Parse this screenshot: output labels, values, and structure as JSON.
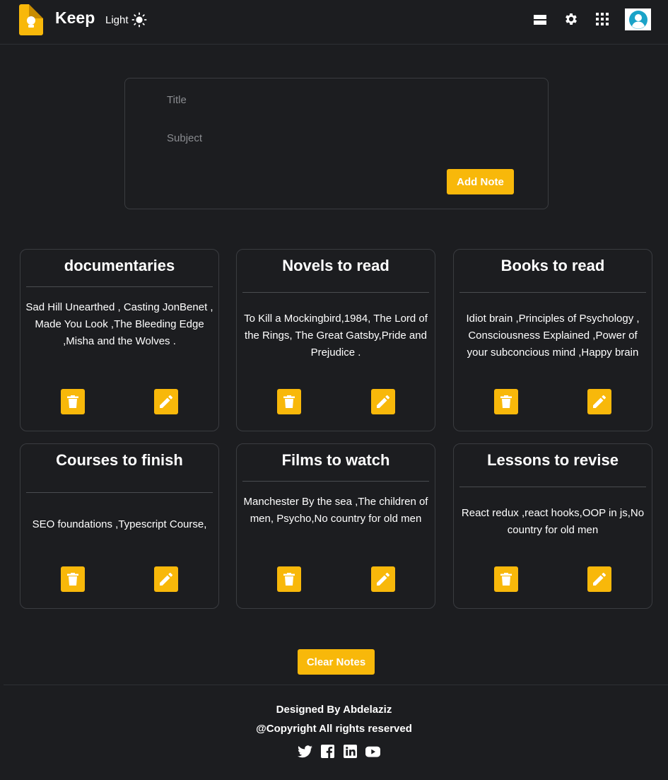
{
  "header": {
    "app_name": "Keep",
    "theme_label": "Light",
    "icons": [
      "sun-icon",
      "view-list-icon",
      "gear-icon",
      "apps-grid-icon",
      "user-avatar-icon"
    ]
  },
  "form": {
    "title_placeholder": "Title",
    "subject_placeholder": "Subject",
    "add_label": "Add Note"
  },
  "notes": [
    {
      "title": "documentaries",
      "body": "Sad Hill Unearthed , Casting JonBenet , Made You Look ,The Bleeding Edge ,Misha and the Wolves ."
    },
    {
      "title": "Novels to read",
      "body": "To Kill a Mockingbird,1984, The Lord of the Rings, The Great Gatsby,Pride and Prejudice ."
    },
    {
      "title": "Books to read",
      "body": "Idiot brain ,Principles of Psychology , Consciousness Explained ,Power of your subconcious mind ,Happy brain"
    },
    {
      "title": "Courses to finish",
      "body": "SEO foundations ,Typescript Course,"
    },
    {
      "title": "Films to watch",
      "body": "Manchester By the sea ,The children of men, Psycho,No country for old men"
    },
    {
      "title": "Lessons to revise",
      "body": "React redux ,react hooks,OOP in js,No country for old men"
    }
  ],
  "clear_label": "Clear Notes",
  "footer": {
    "designed_by": "Designed By Abdelaziz",
    "copyright": "@Copyright All rights reserved",
    "socials": [
      "twitter-icon",
      "facebook-icon",
      "linkedin-icon",
      "youtube-icon"
    ]
  },
  "colors": {
    "background": "#1c1d20",
    "accent": "#f8b80a",
    "border": "#3a3c40",
    "text": "#ffffff"
  }
}
